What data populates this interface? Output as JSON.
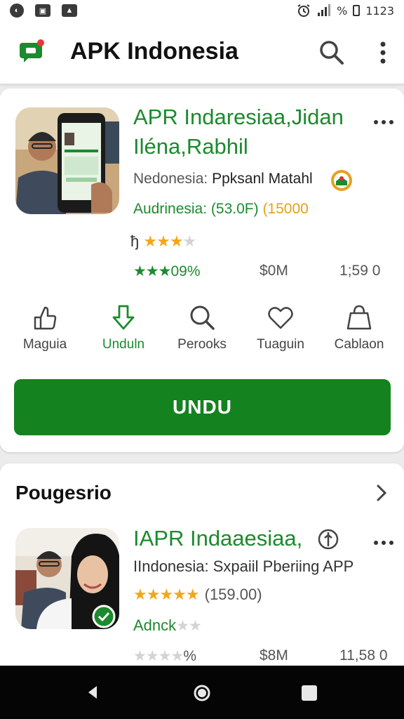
{
  "status_bar": {
    "time": "1123",
    "battery": "%",
    "icons": [
      "notification-icon",
      "sim-icon",
      "image-icon",
      "alarm-icon",
      "signal-icon"
    ]
  },
  "app_bar": {
    "title": "APK Indonesia",
    "icons": [
      "app-logo-icon",
      "search-icon",
      "more-vert-icon"
    ]
  },
  "featured": {
    "title": "APR Indaresiaa,Jidan Iléna,Rabhil",
    "developer_prefix": "Nedonesia:",
    "developer_name": "Ppksanl Matahl",
    "audience_label": "Audrinesia: (53.0F)",
    "audience_count": "(15000",
    "rating_prefix": "ђ",
    "rating_stars": 3.5,
    "score_text": "09%",
    "size": "$0M",
    "downloads": "1;59 0",
    "actions": [
      {
        "label": "Maguia",
        "icon": "thumbs-up-icon"
      },
      {
        "label": "Unduln",
        "icon": "download-icon"
      },
      {
        "label": "Perooks",
        "icon": "search-icon"
      },
      {
        "label": "Tuaguin",
        "icon": "heart-icon"
      },
      {
        "label": "Cablaon",
        "icon": "shopping-bag-icon"
      }
    ],
    "cta_label": "UNDU"
  },
  "suggestions": {
    "title": "Pougesrio",
    "item": {
      "title": "IAPR Indaaesiaa,",
      "developer": "IIndonesia: Sxpaiil Pberiing APP",
      "rating_stars": 5,
      "rating_count": "(159.00)",
      "secondary_label": "Adnck",
      "size_prefix": "%",
      "size": "$8M",
      "downloads": "11,58 0"
    }
  },
  "colors": {
    "accent_green": "#1c8a2e",
    "button_green": "#14821f",
    "star_gold": "#f2a71b"
  }
}
